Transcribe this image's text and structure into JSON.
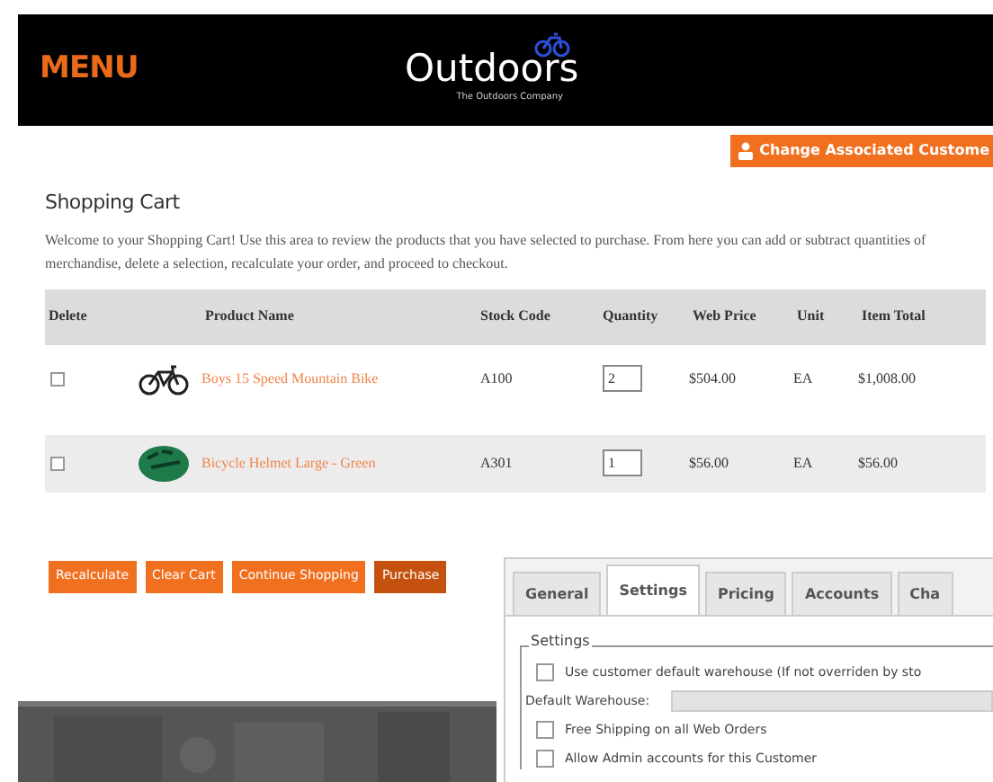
{
  "header": {
    "menu": "MENU",
    "logo": "Outdoors",
    "tagline": "The Outdoors Company",
    "customer_button": "Change Associated Custome"
  },
  "cart": {
    "title": "Shopping Cart",
    "intro": "Welcome to your Shopping Cart! Use this area to review the products that you have selected to purchase. From here you can add or subtract quantities of merchandise, delete a selection, recalculate your order, and proceed to checkout.",
    "columns": [
      "Delete",
      "Product Name",
      "Stock Code",
      "Quantity",
      "Web Price",
      "Unit",
      "Item Total"
    ],
    "rows": [
      {
        "delete": false,
        "kind": "bike",
        "name": "Boys 15 Speed Mountain Bike",
        "stock_code": "A100",
        "quantity": "2",
        "web_price": "$504.00",
        "unit": "EA",
        "item_total": "$1,008.00"
      },
      {
        "delete": false,
        "kind": "helmet",
        "name": "Bicycle Helmet Large - Green",
        "stock_code": "A301",
        "quantity": "1",
        "web_price": "$56.00",
        "unit": "EA",
        "item_total": "$56.00"
      }
    ],
    "buttons": [
      {
        "label": "Recalculate",
        "hovered": false
      },
      {
        "label": "Clear Cart",
        "hovered": false
      },
      {
        "label": "Continue Shopping",
        "hovered": false
      },
      {
        "label": "Purchase",
        "hovered": true
      }
    ]
  },
  "dialog": {
    "tabs": [
      {
        "label": "General",
        "selected": false
      },
      {
        "label": "Settings",
        "selected": true
      },
      {
        "label": "Pricing",
        "selected": false
      },
      {
        "label": "Accounts",
        "selected": false
      },
      {
        "label": "Cha",
        "selected": false
      }
    ],
    "group": "Settings",
    "rows": [
      {
        "kind": "checkbox",
        "label": "Use customer default warehouse (If not overriden by sto",
        "checked": false
      },
      {
        "kind": "field",
        "label": "Default Warehouse:",
        "disabled": true
      },
      {
        "kind": "checkbox",
        "label": "Free Shipping on all Web Orders",
        "checked": false
      },
      {
        "kind": "checkbox",
        "label": "Allow Admin accounts for this Customer",
        "checked": false
      }
    ]
  }
}
